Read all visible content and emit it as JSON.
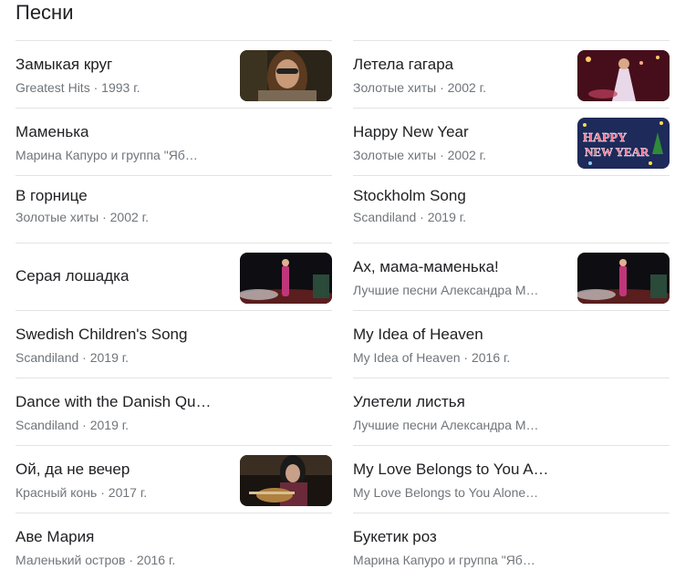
{
  "section": {
    "title": "Песни"
  },
  "songs_left": [
    {
      "name": "Замыкая круг",
      "album": "Greatest Hits",
      "year": "1993 г.",
      "thumb": "video-thumbnail"
    },
    {
      "name": "Маменька",
      "album": "Марина Капуро и группа \"Яб…",
      "year": "",
      "thumb": ""
    },
    {
      "name": "В горнице",
      "album": "Золотые хиты",
      "year": "2002 г.",
      "thumb": ""
    },
    {
      "name": "Серая лошадка",
      "album": "",
      "year": "",
      "thumb": "video-thumbnail"
    },
    {
      "name": "Swedish Children's Song",
      "album": "Scandiland",
      "year": "2019 г.",
      "thumb": ""
    },
    {
      "name": "Dance with the Danish Qu…",
      "album": "Scandiland",
      "year": "2019 г.",
      "thumb": ""
    },
    {
      "name": "Ой, да не вечер",
      "album": "Красный конь",
      "year": "2017 г.",
      "thumb": "video-thumbnail"
    },
    {
      "name": "Аве Мария",
      "album": "Маленький остров",
      "year": "2016 г.",
      "thumb": ""
    }
  ],
  "songs_right": [
    {
      "name": "Летела гагара",
      "album": "Золотые хиты",
      "year": "2002 г.",
      "thumb": "video-thumbnail"
    },
    {
      "name": "Happy New Year",
      "album": "Золотые хиты",
      "year": "2002 г.",
      "thumb": "video-thumbnail",
      "thumb_text": [
        "HAPPY",
        "NEW YEAR"
      ]
    },
    {
      "name": "Stockholm Song",
      "album": "Scandiland",
      "year": "2019 г.",
      "thumb": ""
    },
    {
      "name": "Ах, мама-маменька!",
      "album": "Лучшие песни Александра М…",
      "year": "",
      "thumb": "video-thumbnail"
    },
    {
      "name": "My Idea of Heaven",
      "album": "My Idea of Heaven",
      "year": "2016 г.",
      "thumb": ""
    },
    {
      "name": "Улетели листья",
      "album": "Лучшие песни Александра М…",
      "year": "",
      "thumb": ""
    },
    {
      "name": "My Love Belongs to You A…",
      "album": "My Love Belongs to You Alone…",
      "year": "",
      "thumb": ""
    },
    {
      "name": "Букетик роз",
      "album": "Марина Капуро и группа \"Яб…",
      "year": "",
      "thumb": ""
    }
  ],
  "separator": " · ",
  "colors": {
    "text": "#202124",
    "subtext": "#70757a",
    "divider": "#e3e3e3"
  }
}
